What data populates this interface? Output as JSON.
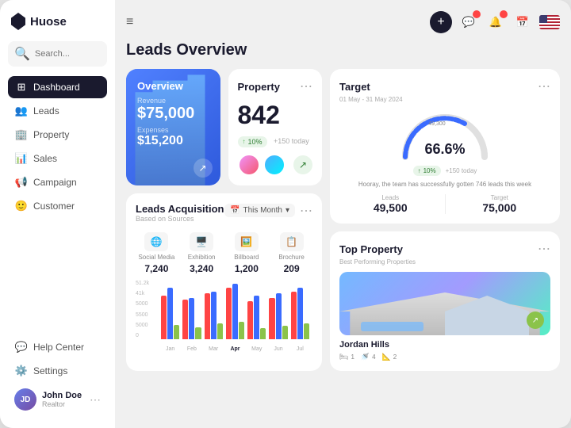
{
  "app": {
    "name": "Huose"
  },
  "sidebar": {
    "search_placeholder": "Search...",
    "nav_items": [
      {
        "id": "dashboard",
        "label": "Dashboard",
        "active": true,
        "icon": "grid"
      },
      {
        "id": "leads",
        "label": "Leads",
        "active": false,
        "icon": "users"
      },
      {
        "id": "property",
        "label": "Property",
        "active": false,
        "icon": "building"
      },
      {
        "id": "sales",
        "label": "Sales",
        "active": false,
        "icon": "chart"
      },
      {
        "id": "campaign",
        "label": "Campaign",
        "active": false,
        "icon": "megaphone"
      },
      {
        "id": "customer",
        "label": "Customer",
        "active": false,
        "icon": "person"
      }
    ],
    "bottom_items": [
      {
        "id": "help",
        "label": "Help Center",
        "icon": "help"
      },
      {
        "id": "settings",
        "label": "Settings",
        "icon": "gear"
      }
    ],
    "user": {
      "name": "John Doe",
      "role": "Realtor"
    }
  },
  "header": {
    "page_title": "Leads Overview",
    "filter_label": "This Month"
  },
  "overview_card": {
    "title": "Overview",
    "revenue_label": "Revenue",
    "revenue_value": "$75,000",
    "expenses_label": "Expenses",
    "expenses_value": "$15,200"
  },
  "property_card": {
    "title": "Property",
    "count": "842",
    "badge": "10%",
    "badge_arrow": "↑",
    "today": "+150 today"
  },
  "leads_acquisition": {
    "title": "Leads Acquisition",
    "subtitle": "Based on Sources",
    "filter": "This Month",
    "sources": [
      {
        "icon": "🌐",
        "label": "Social Media",
        "value": "7,240"
      },
      {
        "icon": "🖥️",
        "label": "Exhibition",
        "value": "3,240"
      },
      {
        "icon": "🖼️",
        "label": "Billboard",
        "value": "1,200"
      },
      {
        "icon": "📋",
        "label": "Brochure",
        "value": "209"
      }
    ],
    "chart": {
      "y_labels": [
        "51.2k",
        "41k",
        "5000",
        "5500",
        "5000",
        "0"
      ],
      "x_labels": [
        "Jan",
        "Feb",
        "Mar",
        "Apr",
        "May",
        "Jun",
        "Jul"
      ],
      "active_month": "Apr",
      "bars": [
        {
          "month": "Jan",
          "red": 55,
          "blue": 65,
          "green": 18
        },
        {
          "month": "Feb",
          "red": 50,
          "blue": 52,
          "green": 15
        },
        {
          "month": "Mar",
          "red": 58,
          "blue": 60,
          "green": 20
        },
        {
          "month": "Apr",
          "red": 65,
          "blue": 70,
          "green": 22
        },
        {
          "month": "May",
          "red": 48,
          "blue": 55,
          "green": 14
        },
        {
          "month": "Jun",
          "red": 52,
          "blue": 58,
          "green": 17
        },
        {
          "month": "Jul",
          "red": 60,
          "blue": 65,
          "green": 20
        }
      ]
    }
  },
  "target_card": {
    "title": "Target",
    "date_range": "01 May - 31 May 2024",
    "gauge_label": "49,300",
    "percent": "66.6%",
    "badge": "10%",
    "badge_arrow": "↑",
    "badge_note": "+150 today",
    "note": "Hooray, the team has successfully gotten 746 leads this week",
    "leads_label": "Leads",
    "leads_value": "49,500",
    "target_label": "Target",
    "target_value": "75,000"
  },
  "top_property": {
    "title": "Top Property",
    "subtitle": "Best Performing Properties",
    "property_name": "Jordan Hills",
    "beds": "1",
    "baths": "4",
    "area": "2"
  }
}
